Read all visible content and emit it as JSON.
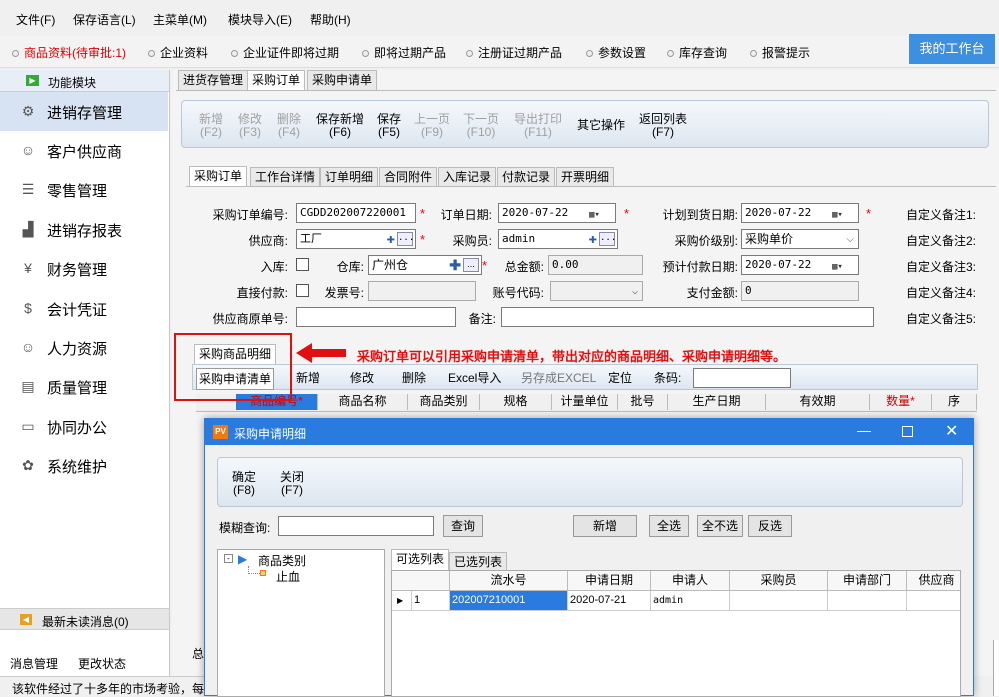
{
  "menu": [
    "文件(F)",
    "保存语言(L)",
    "主菜单(M)",
    "模块导入(E)",
    "帮助(H)"
  ],
  "topnav": [
    "商品资料(待审批:1)",
    "企业资料",
    "企业证件即将过期",
    "即将过期产品",
    "注册证过期产品",
    "参数设置",
    "库存查询",
    "报警提示"
  ],
  "workbench": "我的工作台",
  "sidebar": {
    "header": "功能模块",
    "items": [
      "进销存管理",
      "客户供应商",
      "零售管理",
      "进销存报表",
      "财务管理",
      "会计凭证",
      "人力资源",
      "质量管理",
      "协同办公",
      "系统维护"
    ],
    "unread": "最新未读消息(0)",
    "footer_left": "消息管理",
    "footer_right": "更改状态"
  },
  "status_text": "该软件经过了十多年的市场考验，每",
  "main": {
    "tabs": [
      "进货存管理",
      "采购订单",
      "采购申请单"
    ],
    "toolbar": [
      [
        "新增",
        "(F2)"
      ],
      [
        "修改",
        "(F3)"
      ],
      [
        "删除",
        "(F4)"
      ],
      [
        "保存新增",
        "(F6)"
      ],
      [
        "保存",
        "(F5)"
      ],
      [
        "上一页",
        "(F9)"
      ],
      [
        "下一页",
        "(F10)"
      ],
      [
        "导出打印",
        "(F11)"
      ],
      [
        "其它操作",
        ""
      ],
      [
        "返回列表",
        "(F7)"
      ]
    ],
    "subtabs": [
      "采购订单",
      "工作台详情",
      "订单明细",
      "合同附件",
      "入库记录",
      "付款记录",
      "开票明细"
    ],
    "form": {
      "order_no_label": "采购订单编号:",
      "order_no": "CGDD202007220001",
      "order_date_label": "订单日期:",
      "order_date": "2020-07-22",
      "plan_date_label": "计划到货日期:",
      "plan_date": "2020-07-22",
      "supplier_label": "供应商:",
      "supplier": "工厂",
      "buyer_label": "采购员:",
      "buyer": "admin",
      "price_level_label": "采购价级别:",
      "price_level": "采购单价",
      "instock_label": "入库:",
      "warehouse_label": "仓库:",
      "warehouse": "广州仓",
      "total_label": "总金额:",
      "total": "0.00",
      "prepay_label": "预计付款日期:",
      "prepay": "2020-07-22",
      "direct_pay_label": "直接付款:",
      "invoice_label": "发票号:",
      "account_label": "账号代码:",
      "pay_amount_label": "支付金额:",
      "pay_amount": "0",
      "orig_no_label": "供应商原单号:",
      "remark_label": "备注:",
      "custom": [
        "自定义备注1:",
        "自定义备注2:",
        "自定义备注3:",
        "自定义备注4:",
        "自定义备注5:"
      ]
    },
    "detail_tab": "采购商品明细",
    "detail_toolbar": [
      "采购申请清单",
      "新增",
      "修改",
      "删除",
      "Excel导入",
      "另存成EXCEL",
      "定位",
      "条码:"
    ],
    "grid_headers": [
      "商品编号*",
      "商品名称",
      "商品类别",
      "规格",
      "计量单位",
      "批号",
      "生产日期",
      "有效期",
      "数量*",
      "序"
    ],
    "footer_partial": "总"
  },
  "annotation": "采购订单可以引用采购申请清单，带出对应的商品明细、采购申请明细等。",
  "dialog": {
    "title": "采购申请明细",
    "buttons": [
      [
        "确定",
        "(F8)"
      ],
      [
        "关闭",
        "(F7)"
      ]
    ],
    "search_label": "模糊查询:",
    "query": "查询",
    "add": "新增",
    "select_all": "全选",
    "select_none": "全不选",
    "invert": "反选",
    "tree_root": "商品类别",
    "tree_child": "止血",
    "tabs": [
      "可选列表",
      "已选列表"
    ],
    "headers": [
      "流水号",
      "申请日期",
      "申请人",
      "采购员",
      "申请部门",
      "供应商"
    ],
    "rows": [
      {
        "idx": "1",
        "no": "202007210001",
        "date": "2020-07-21",
        "applicant": "admin",
        "buyer": "",
        "dept": "",
        "supplier": ""
      }
    ]
  }
}
